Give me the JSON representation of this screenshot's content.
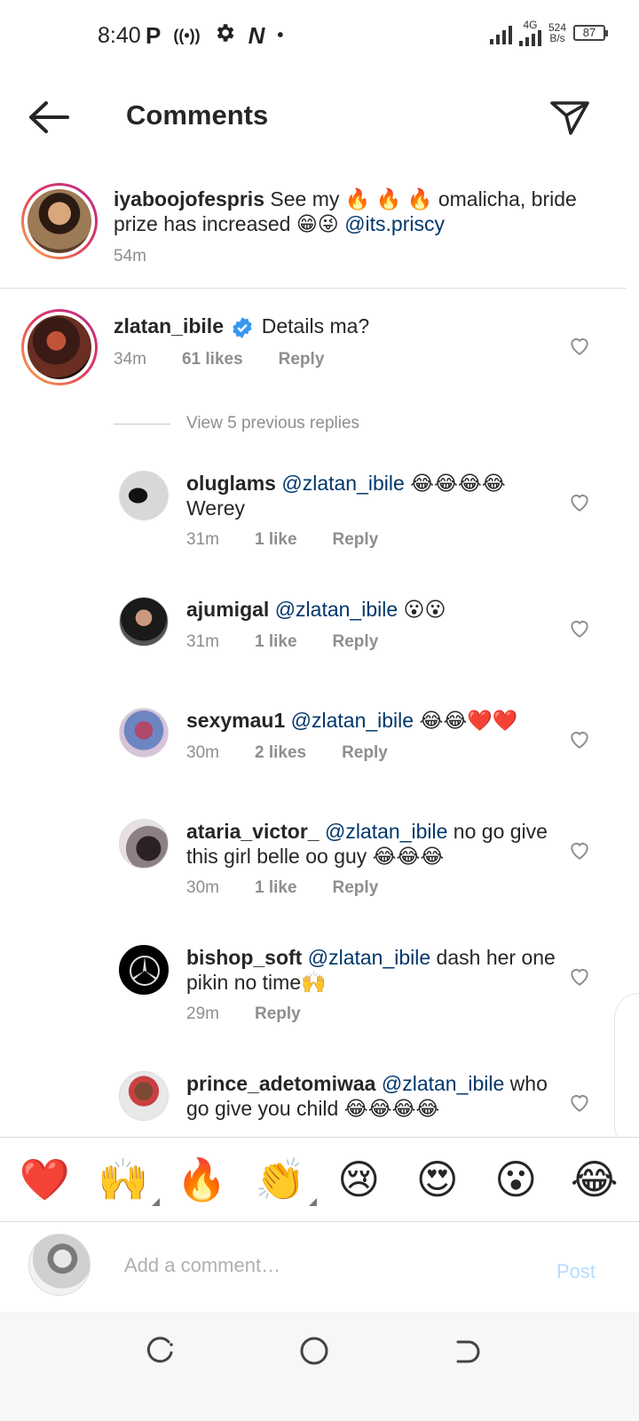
{
  "status_bar": {
    "time": "8:40",
    "left_icons": [
      "P",
      "((•))",
      "gear-icon",
      "N",
      "•"
    ],
    "network": "4G",
    "speed_value": "524",
    "speed_unit": "B/s",
    "battery": "87"
  },
  "header": {
    "title": "Comments"
  },
  "caption": {
    "username": "iyaboojofespris",
    "text_before": " See my 🔥 🔥 🔥 omalicha, bride prize has increased 😁😜 ",
    "mention": "@its.priscy",
    "time": "54m"
  },
  "main_comment": {
    "username": "zlatan_ibile",
    "text": "Details ma?",
    "time": "34m",
    "likes": "61 likes",
    "reply": "Reply"
  },
  "view_previous": "View 5 previous replies",
  "replies": [
    {
      "username": "oluglams",
      "mention": "@zlatan_ibile",
      "text": " 😂😂😂😂 Werey",
      "time": "31m",
      "likes": "1 like",
      "reply": "Reply"
    },
    {
      "username": "ajumigal",
      "mention": "@zlatan_ibile",
      "text": " 😮😮",
      "time": "31m",
      "likes": "1 like",
      "reply": "Reply"
    },
    {
      "username": "sexymau1",
      "mention": "@zlatan_ibile",
      "text": " 😂😂❤️❤️",
      "time": "30m",
      "likes": "2 likes",
      "reply": "Reply"
    },
    {
      "username": "ataria_victor_",
      "mention": "@zlatan_ibile",
      "text": " no go give this girl belle oo guy 😂😂😂",
      "time": "30m",
      "likes": "1 like",
      "reply": "Reply"
    },
    {
      "username": "bishop_soft",
      "mention": "@zlatan_ibile",
      "text": " dash her one pikin no time🙌",
      "time": "29m",
      "likes": "",
      "reply": "Reply"
    },
    {
      "username": "prince_adetomiwaa",
      "mention": "@zlatan_ibile",
      "text": " who go give you child 😂😂😂😂",
      "time": "",
      "likes": "",
      "reply": ""
    }
  ],
  "emoji_bar": [
    "❤️",
    "🙌",
    "🔥",
    "👏",
    "😢",
    "😍",
    "😮",
    "😂"
  ],
  "comment_input": {
    "placeholder": "Add a comment…",
    "post_label": "Post"
  },
  "colors": {
    "mention": "#00376b",
    "meta": "#8e8e8e",
    "post_disabled": "#b3dbff",
    "verified": "#3897f0"
  }
}
